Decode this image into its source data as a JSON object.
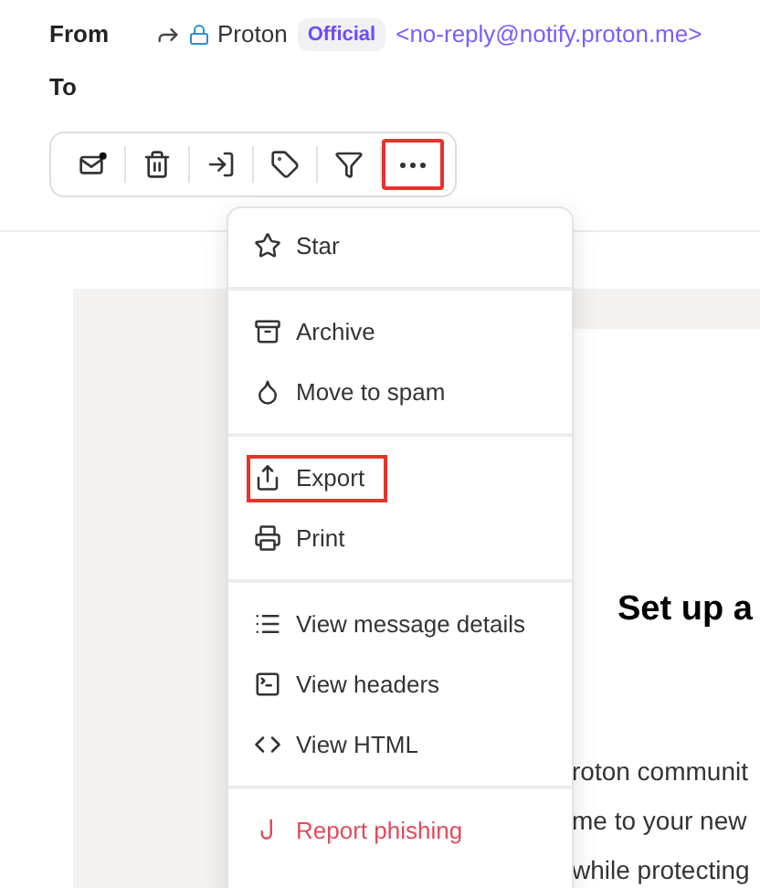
{
  "header": {
    "from_label": "From",
    "sender_name": "Proton",
    "badge": "Official",
    "sender_address": "<no-reply@notify.proton.me>",
    "to_label": "To"
  },
  "toolbar": [
    {
      "kind": "unread",
      "highlighted": false
    },
    {
      "kind": "trash",
      "highlighted": false
    },
    {
      "kind": "move",
      "highlighted": false
    },
    {
      "kind": "label",
      "highlighted": false
    },
    {
      "kind": "filter",
      "highlighted": false
    },
    {
      "kind": "more",
      "highlighted": true
    }
  ],
  "menu": {
    "sections": [
      [
        {
          "kind": "star",
          "label": "Star",
          "highlighted": false,
          "danger": false
        }
      ],
      [
        {
          "kind": "archive",
          "label": "Archive",
          "highlighted": false,
          "danger": false
        },
        {
          "kind": "spam",
          "label": "Move to spam",
          "highlighted": false,
          "danger": false
        }
      ],
      [
        {
          "kind": "export",
          "label": "Export",
          "highlighted": true,
          "danger": false
        },
        {
          "kind": "print",
          "label": "Print",
          "highlighted": false,
          "danger": false
        }
      ],
      [
        {
          "kind": "details",
          "label": "View message details",
          "highlighted": false,
          "danger": false
        },
        {
          "kind": "headers",
          "label": "View headers",
          "highlighted": false,
          "danger": false
        },
        {
          "kind": "html",
          "label": "View HTML",
          "highlighted": false,
          "danger": false
        }
      ],
      [
        {
          "kind": "phishing",
          "label": "Report phishing",
          "highlighted": false,
          "danger": true
        }
      ]
    ]
  },
  "message": {
    "heading": "Set up a",
    "lines": [
      "roton communit",
      "me to your new",
      "while protecting"
    ]
  }
}
